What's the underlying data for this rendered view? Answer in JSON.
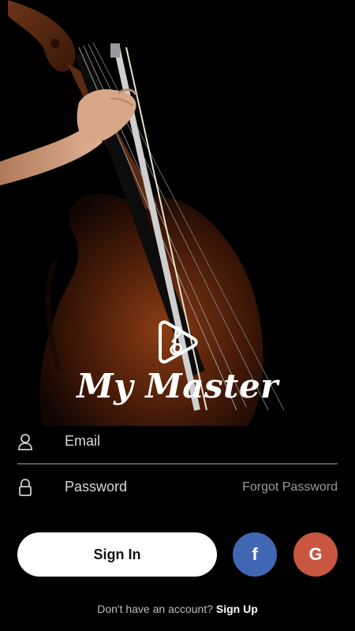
{
  "app": {
    "name": "My Master"
  },
  "form": {
    "email_label": "Email",
    "password_label": "Password",
    "forgot_label": "Forgot Password"
  },
  "buttons": {
    "signin_label": "Sign In",
    "facebook_glyph": "f",
    "google_glyph": "G"
  },
  "footer": {
    "prompt": "Don't have an account?",
    "signup_label": "Sign Up"
  },
  "colors": {
    "background": "#000000",
    "facebook": "#4267B2",
    "google": "#C85640",
    "signin_bg": "#FFFFFF"
  },
  "icons": {
    "email": "user-icon",
    "password": "lock-icon",
    "logo": "play-treble-clef-logo"
  }
}
